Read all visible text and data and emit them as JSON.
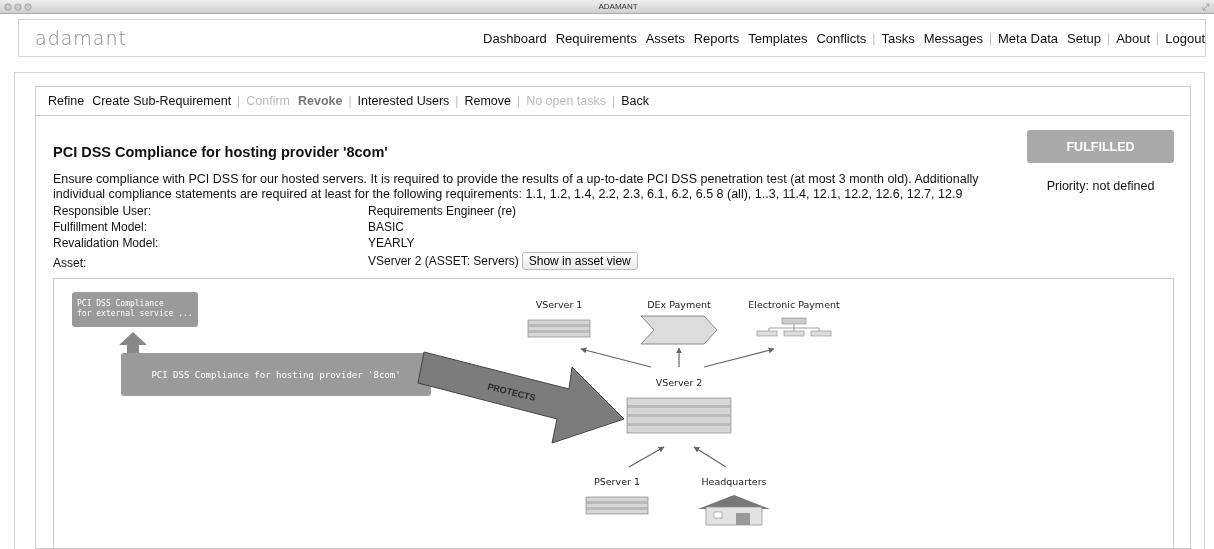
{
  "window": {
    "title": "ADAMANT"
  },
  "header": {
    "logo": "adamant",
    "nav": [
      {
        "kind": "link",
        "label": "Dashboard"
      },
      {
        "kind": "link",
        "label": "Requirements"
      },
      {
        "kind": "link",
        "label": "Assets"
      },
      {
        "kind": "link",
        "label": "Reports"
      },
      {
        "kind": "link",
        "label": "Templates"
      },
      {
        "kind": "link",
        "label": "Conflicts"
      },
      {
        "kind": "separator",
        "label": "|"
      },
      {
        "kind": "link",
        "label": "Tasks"
      },
      {
        "kind": "link",
        "label": "Messages"
      },
      {
        "kind": "separator",
        "label": "|"
      },
      {
        "kind": "link",
        "label": "Meta Data"
      },
      {
        "kind": "link",
        "label": "Setup"
      },
      {
        "kind": "separator",
        "label": "|"
      },
      {
        "kind": "link",
        "label": "About"
      },
      {
        "kind": "separator",
        "label": "|"
      },
      {
        "kind": "link",
        "label": "Logout"
      }
    ]
  },
  "actions": [
    {
      "kind": "link",
      "label": "Refine",
      "disabled": false,
      "bold": false
    },
    {
      "kind": "link",
      "label": "Create Sub-Requirement",
      "disabled": false,
      "bold": false
    },
    {
      "kind": "separator",
      "label": "|"
    },
    {
      "kind": "link",
      "label": "Confirm",
      "disabled": true,
      "bold": false
    },
    {
      "kind": "link",
      "label": "Revoke",
      "disabled": false,
      "bold": true
    },
    {
      "kind": "separator",
      "label": "|"
    },
    {
      "kind": "link",
      "label": "Interested Users",
      "disabled": false,
      "bold": false
    },
    {
      "kind": "separator",
      "label": "|"
    },
    {
      "kind": "link",
      "label": "Remove",
      "disabled": false,
      "bold": false
    },
    {
      "kind": "separator",
      "label": "|"
    },
    {
      "kind": "link",
      "label": "No open tasks",
      "disabled": true,
      "bold": false
    },
    {
      "kind": "separator",
      "label": "|"
    },
    {
      "kind": "link",
      "label": "Back",
      "disabled": false,
      "bold": false
    }
  ],
  "requirement": {
    "title": "PCI DSS Compliance for hosting provider '8com'",
    "description": "Ensure compliance with PCI DSS for our hosted servers. It is required to provide the results of a up-to-date PCI DSS penetration test (at most 3 month old). Additionally individual compliance statements are required at least for the following requirements: 1.1, 1.2, 1.4, 2.2, 2.3, 6.1, 6.2, 6.5 8 (all), 1..3, 11.4, 12.1, 12.2, 12.6, 12.7, 12.9",
    "status": "FULFILLED",
    "priority": "Priority: not defined",
    "fields": [
      {
        "label": "Responsible User:",
        "value": "Requirements Engineer (re)"
      },
      {
        "label": "Fulfillment Model:",
        "value": "BASIC"
      },
      {
        "label": "Revalidation Model:",
        "value": "YEARLY"
      },
      {
        "label": "Asset:",
        "value": "VServer 2 (ASSET: Servers)",
        "button": "Show in asset view"
      }
    ]
  },
  "diagram": {
    "requirements": [
      {
        "label_lines": [
          "PCI DSS Compliance",
          "for external service ..."
        ]
      },
      {
        "label_lines": [
          "PCI DSS Compliance for hosting provider '8com'"
        ]
      }
    ],
    "relation": "PROTECTS",
    "assets": [
      {
        "kind": "server",
        "label": "VServer 1"
      },
      {
        "kind": "process",
        "label": "DEx Payment"
      },
      {
        "kind": "network",
        "label": "Electronic Payment"
      },
      {
        "kind": "server",
        "label": "VServer 2"
      },
      {
        "kind": "server",
        "label": "PServer 1"
      },
      {
        "kind": "building",
        "label": "Headquarters"
      }
    ]
  }
}
